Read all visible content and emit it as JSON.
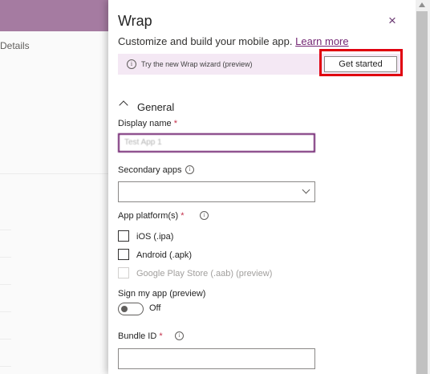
{
  "background": {
    "details_label": "Details"
  },
  "panel": {
    "title": "Wrap",
    "close_icon": "×",
    "subtitle": "Customize and build your mobile app.",
    "learn_more": "Learn more",
    "banner": {
      "info_icon": "i",
      "text": "Try the new Wrap wizard (preview)",
      "button": "Get started"
    },
    "section": {
      "title": "General"
    },
    "display_name": {
      "label": "Display name",
      "required": "*",
      "value": "Test App 1"
    },
    "secondary_apps": {
      "label": "Secondary apps",
      "info_icon": "i",
      "value": ""
    },
    "platforms": {
      "label": "App platform(s)",
      "required": "*",
      "info_icon": "i",
      "options": [
        "iOS (.ipa)",
        "Android (.apk)",
        "Google Play Store (.aab) (preview)"
      ]
    },
    "sign_app": {
      "label": "Sign my app (preview)",
      "state": "Off"
    },
    "bundle_id": {
      "label": "Bundle ID",
      "required": "*",
      "info_icon": "i",
      "value": ""
    }
  },
  "colors": {
    "accent": "#742774",
    "topbar": "#a57ba1",
    "banner_bg": "#f4e8f4",
    "highlight": "#e0000f"
  }
}
